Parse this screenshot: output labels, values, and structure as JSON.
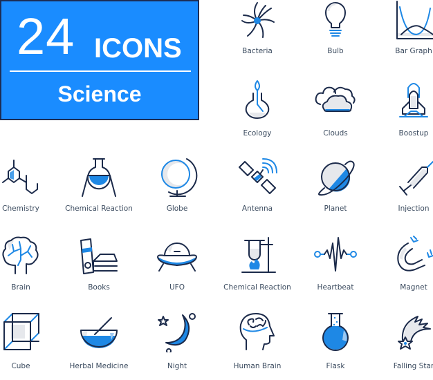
{
  "banner": {
    "count": "24",
    "word": "ICONS",
    "category": "Science"
  },
  "colors": {
    "banner_bg": "#1a8cff",
    "banner_border": "#1c2d55",
    "icon_stroke": "#1b2a4a",
    "icon_accent": "#1e88e5",
    "icon_fill": "#e6e8ec",
    "label_text": "#3a4a5e"
  },
  "icons": [
    {
      "id": "bacteria",
      "label": "Bacteria"
    },
    {
      "id": "bulb",
      "label": "Bulb"
    },
    {
      "id": "bar-graph",
      "label": "Bar Graph"
    },
    {
      "id": "ecology",
      "label": "Ecology"
    },
    {
      "id": "clouds",
      "label": "Clouds"
    },
    {
      "id": "boostup",
      "label": "Boostup"
    },
    {
      "id": "chemistry",
      "label": "Chemistry"
    },
    {
      "id": "chemical-reaction-1",
      "label": "Chemical Reaction"
    },
    {
      "id": "globe",
      "label": "Globe"
    },
    {
      "id": "antenna",
      "label": "Antenna"
    },
    {
      "id": "planet",
      "label": "Planet"
    },
    {
      "id": "injection",
      "label": "Injection"
    },
    {
      "id": "brain",
      "label": "Brain"
    },
    {
      "id": "books",
      "label": "Books"
    },
    {
      "id": "ufo",
      "label": "UFO"
    },
    {
      "id": "chemical-reaction-2",
      "label": "Chemical Reaction"
    },
    {
      "id": "heartbeat",
      "label": "Heartbeat"
    },
    {
      "id": "magnet",
      "label": "Magnet"
    },
    {
      "id": "cube",
      "label": "Cube"
    },
    {
      "id": "herbal-medicine",
      "label": "Herbal Medicine"
    },
    {
      "id": "night",
      "label": "Night"
    },
    {
      "id": "human-brain",
      "label": "Human Brain"
    },
    {
      "id": "flask",
      "label": "Flask"
    },
    {
      "id": "falling-star",
      "label": "Falling Star"
    }
  ]
}
